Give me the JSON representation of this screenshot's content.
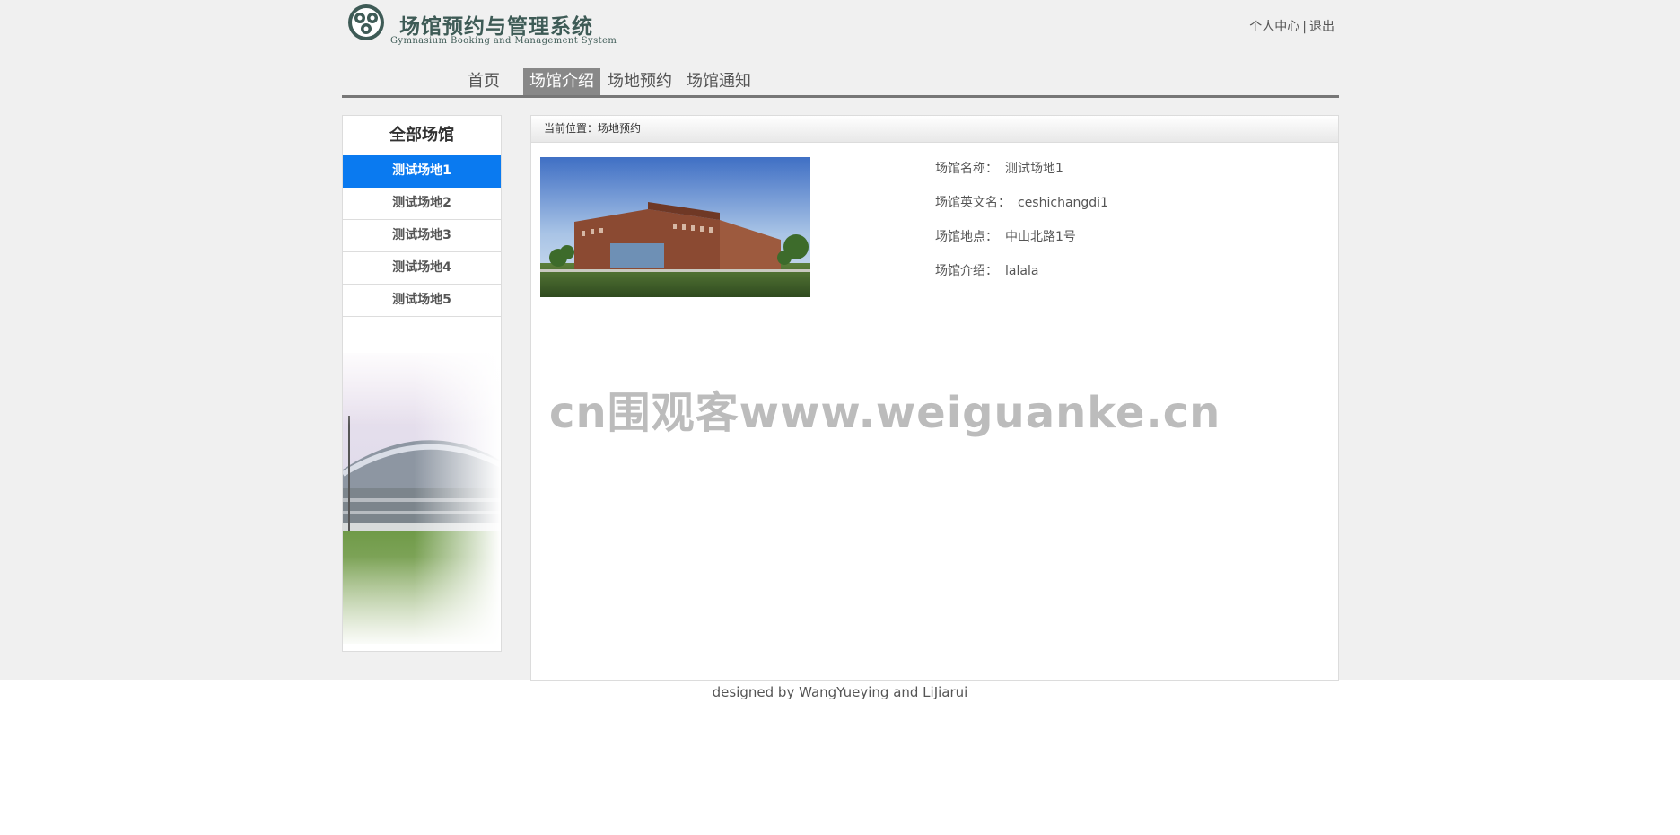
{
  "header": {
    "logo_title": "场馆预约与管理系统",
    "logo_subtitle": "Gymnasium Booking and Management System",
    "user_center_link": "个人中心",
    "separator": "|",
    "logout_link": "退出"
  },
  "nav": {
    "items": [
      {
        "label": "首页"
      },
      {
        "label": "场馆介绍"
      },
      {
        "label": "场地预约"
      },
      {
        "label": "场馆通知"
      }
    ],
    "active_index": 1
  },
  "sidebar": {
    "title": "全部场馆",
    "items": [
      {
        "label": "测试场地1"
      },
      {
        "label": "测试场地2"
      },
      {
        "label": "测试场地3"
      },
      {
        "label": "测试场地4"
      },
      {
        "label": "测试场地5"
      }
    ],
    "active_index": 0
  },
  "content": {
    "breadcrumb": "当前位置：场地预约",
    "fields": [
      {
        "label": "场馆名称：",
        "value": "测试场地1"
      },
      {
        "label": "场馆英文名：",
        "value": "ceshichangdi1"
      },
      {
        "label": "场馆地点：",
        "value": "中山北路1号"
      },
      {
        "label": "场馆介绍：",
        "value": "lalala"
      }
    ]
  },
  "watermark": "cn围观客www.weiguanke.cn",
  "footer": "designed by WangYueying and LiJiarui",
  "colors": {
    "page_bg": "#f0f0f0",
    "active_nav_bg": "#888888",
    "active_sidebar_bg": "#0a7af0",
    "logo_green": "#3e5b56"
  },
  "icons": {
    "logo_emblem": "gymnasium-emblem-icon"
  }
}
